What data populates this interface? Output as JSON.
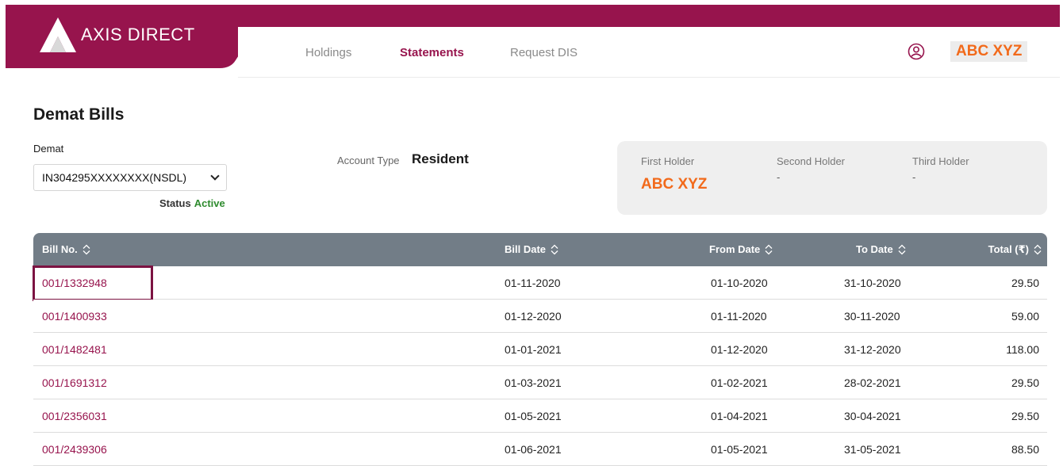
{
  "header": {
    "brand": "AXIS DIRECT",
    "nav": [
      "Holdings",
      "Statements",
      "Request DIS"
    ],
    "active_nav": "Statements",
    "user_name": "ABC XYZ",
    "brand_color": "#97144d",
    "icons": [
      "axis-logo-icon",
      "user-circle-icon"
    ]
  },
  "page": {
    "title": "Demat Bills",
    "demat_label": "Demat",
    "demat_selected": "IN304295XXXXXXXX(NSDL)",
    "status_label": "Status",
    "status_value": "Active",
    "account_type_label": "Account Type",
    "account_type_value": "Resident"
  },
  "holders": {
    "first_label": "First Holder",
    "first_value": "ABC XYZ",
    "second_label": "Second Holder",
    "second_value": "-",
    "third_label": "Third Holder",
    "third_value": "-"
  },
  "table": {
    "columns": [
      "Bill No.",
      "Bill Date",
      "From Date",
      "To Date",
      "Total (₹)"
    ],
    "rows": [
      {
        "bill_no": "001/1332948",
        "bill_date": "01-11-2020",
        "from_date": "01-10-2020",
        "to_date": "31-10-2020",
        "total": "29.50"
      },
      {
        "bill_no": "001/1400933",
        "bill_date": "01-12-2020",
        "from_date": "01-11-2020",
        "to_date": "30-11-2020",
        "total": "59.00"
      },
      {
        "bill_no": "001/1482481",
        "bill_date": "01-01-2021",
        "from_date": "01-12-2020",
        "to_date": "31-12-2020",
        "total": "118.00"
      },
      {
        "bill_no": "001/1691312",
        "bill_date": "01-03-2021",
        "from_date": "01-02-2021",
        "to_date": "28-02-2021",
        "total": "29.50"
      },
      {
        "bill_no": "001/2356031",
        "bill_date": "01-05-2021",
        "from_date": "01-04-2021",
        "to_date": "30-04-2021",
        "total": "29.50"
      },
      {
        "bill_no": "001/2439306",
        "bill_date": "01-06-2021",
        "from_date": "01-05-2021",
        "to_date": "31-05-2021",
        "total": "88.50"
      }
    ]
  }
}
